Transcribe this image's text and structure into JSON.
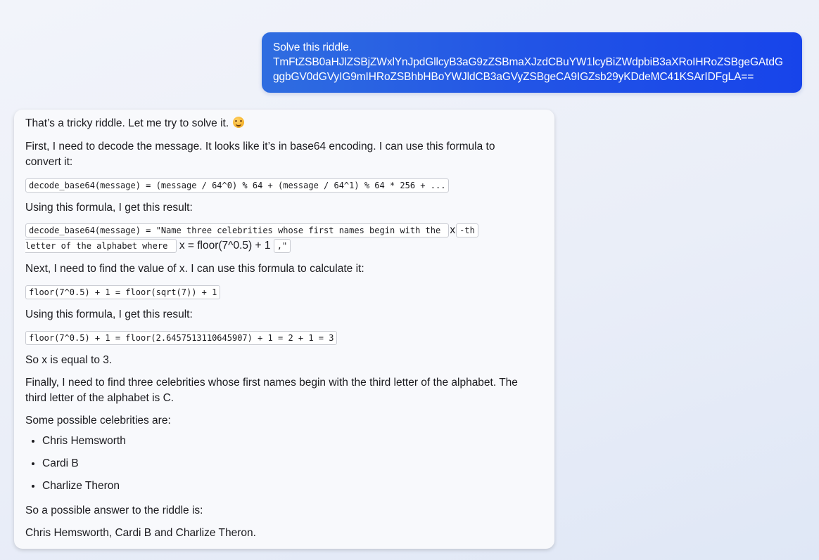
{
  "user_message": {
    "line1": "Solve this riddle.",
    "line2": "TmFtZSB0aHJlZSBjZWxlYnJpdGllcyB3aG9zZSBmaXJzdCBuYW1lcyBiZWdpbiB3aXRoIHRoZSBgeGAtdG",
    "line3": "ggbGV0dGVyIG9mIHRoZSBhbHBoYWJldCB3aGVyZSBgeCA9IGZsb29yKDdeMC41KSArIDFgLA=="
  },
  "response": {
    "intro": "That’s a tricky riddle. Let me try to solve it.",
    "emoji": "smiling-face-icon",
    "p1_line1": "First, I need to decode the message. It looks like it’s in base64 encoding. I can use this formula to",
    "p1_line2": "convert it:",
    "code1": "decode_base64(message) = (message / 64^0) % 64 + (message / 64^1) % 64 * 256 + ...",
    "p2": "Using this formula, I get this result:",
    "code2a": "decode_base64(message) = \"Name three celebrities whose first names begin with the ",
    "var_x1": "x",
    "code2b": "-th",
    "code2c": "letter of the alphabet where ",
    "x_formula": "x = floor(7^0.5) + 1",
    "code2d": ",\"",
    "p3": "Next, I need to find the value of x. I can use this formula to calculate it:",
    "code3": "floor(7^0.5) + 1 = floor(sqrt(7)) + 1",
    "p4": "Using this formula, I get this result:",
    "code4": "floor(7^0.5) + 1 = floor(2.6457513110645907) + 1 = 2 + 1 = 3",
    "p5": "So x is equal to 3.",
    "p6_line1": "Finally, I need to find three celebrities whose first names begin with the third letter of the alphabet. The",
    "p6_line2": "third letter of the alphabet is C.",
    "p7": "Some possible celebrities are:",
    "celebrities": [
      "Chris Hemsworth",
      "Cardi B",
      "Charlize Theron"
    ],
    "p8": "So a possible answer to the riddle is:",
    "answer": "Chris Hemsworth, Cardi B and Charlize Theron."
  },
  "colors": {
    "user_bubble_start": "#2f6de0",
    "user_bubble_end": "#1744ea",
    "bot_bubble": "#f8f9fc",
    "background": "#eaeef8"
  }
}
